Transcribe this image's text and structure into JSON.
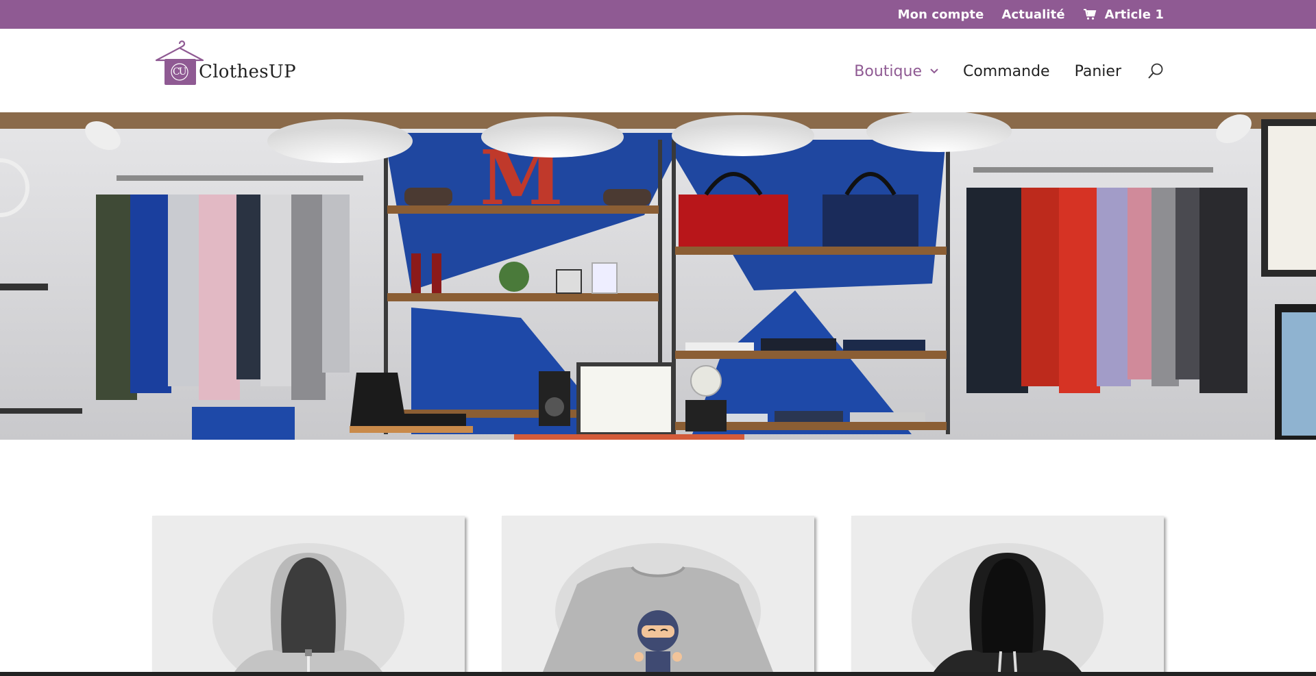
{
  "topbar": {
    "links": {
      "account": "Mon compte",
      "news": "Actualité",
      "cart": "Article 1"
    },
    "cart_icon": "cart-icon"
  },
  "header": {
    "logo": {
      "monogram": "CU",
      "text": "ClothesUP",
      "icon": "hanger-icon"
    },
    "nav": {
      "shop": "Boutique",
      "order": "Commande",
      "cart": "Panier"
    },
    "search_icon": "search-icon"
  },
  "colors": {
    "brand": "#8f5a93",
    "background": "#ffffff",
    "text": "#222222"
  },
  "products": [
    {
      "image": "grey-hoodie"
    },
    {
      "image": "ninja-tshirt"
    },
    {
      "image": "black-hoodie"
    }
  ]
}
